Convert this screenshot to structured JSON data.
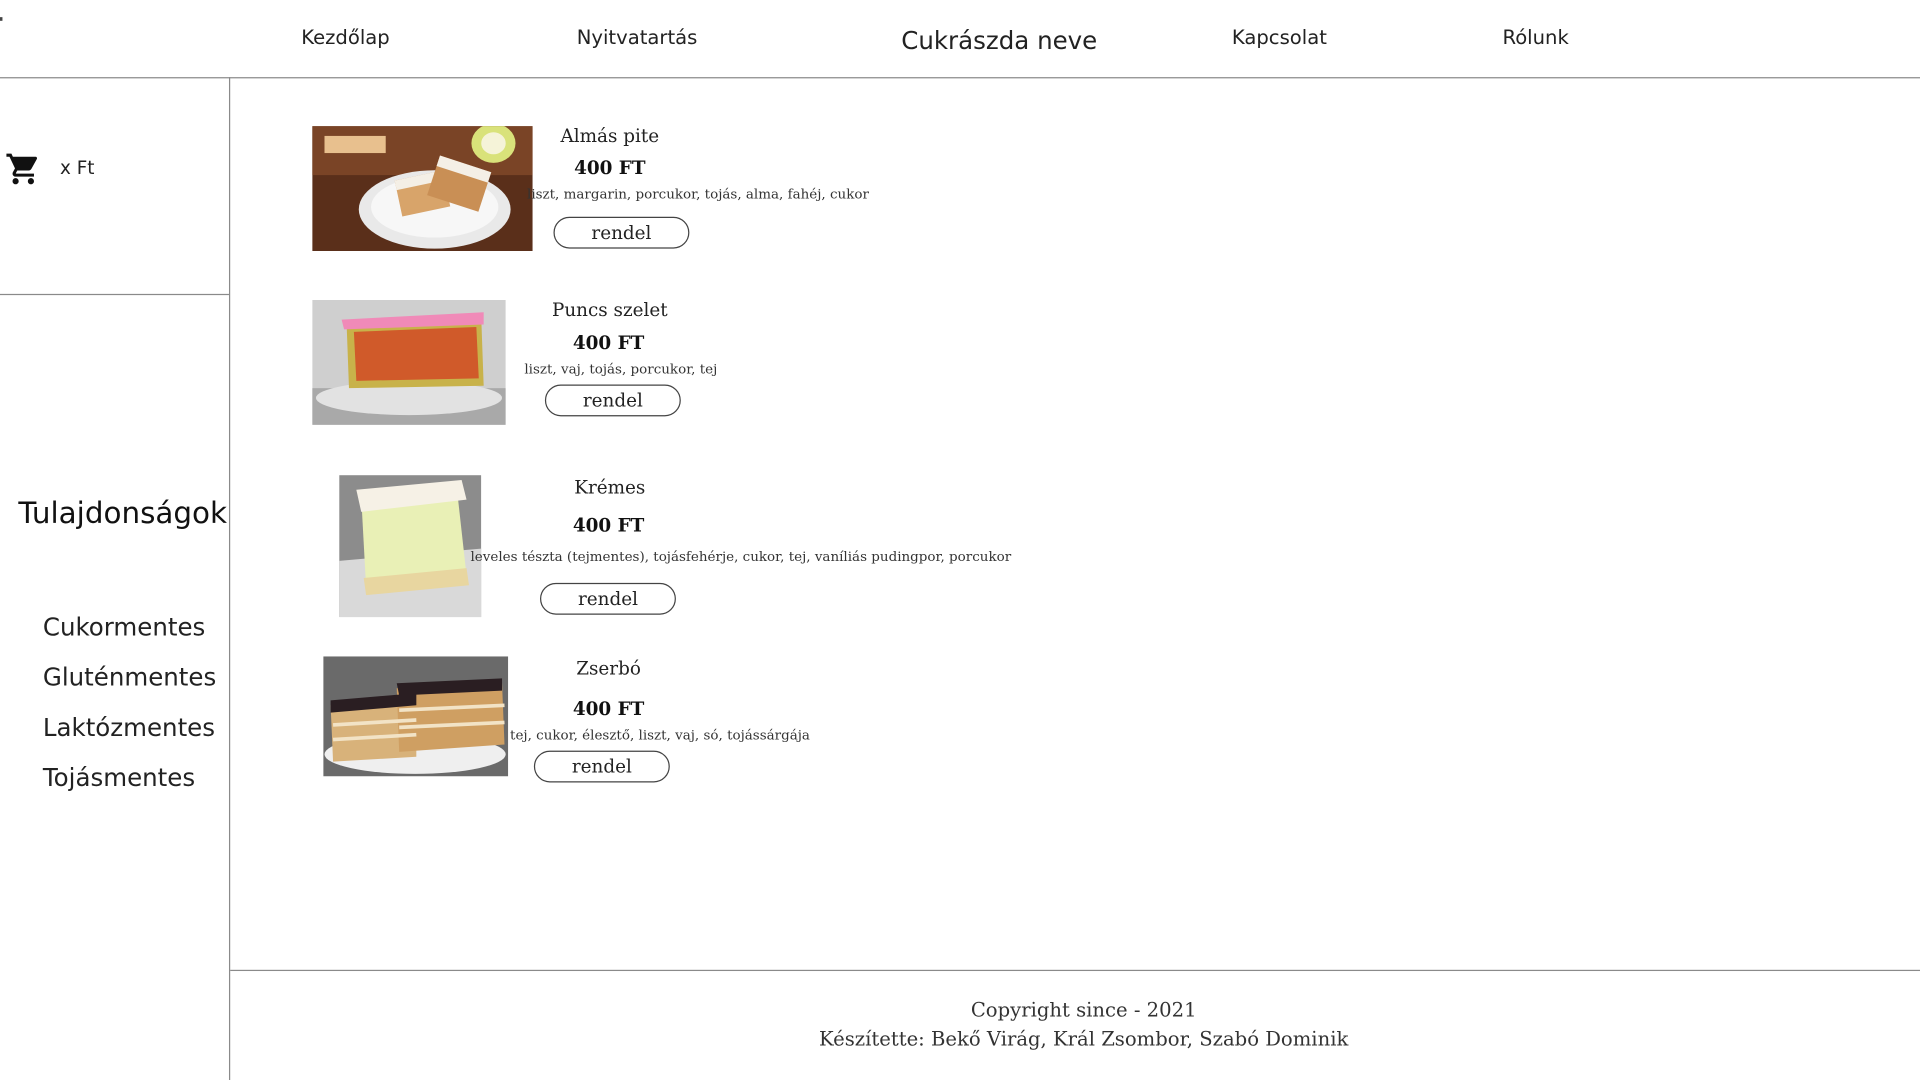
{
  "header": {
    "nav": [
      "Kezdőlap",
      "Nyitvatartás",
      "Kapcsolat",
      "Rólunk"
    ],
    "brand": "Cukrászda neve"
  },
  "sidebar": {
    "cart_amount": "x Ft",
    "title": "Tulajdonságok",
    "filters": [
      "Cukormentes",
      "Gluténmentes",
      "Laktózmentes",
      "Tojásmentes"
    ]
  },
  "products": [
    {
      "name": "Almás pite",
      "price": "400 FT",
      "ingredients": "liszt, margarin, porcukor, tojás, alma, fahéj, cukor",
      "button": "rendel"
    },
    {
      "name": "Puncs szelet",
      "price": "400 FT",
      "ingredients": "liszt, vaj, tojás, porcukor, tej",
      "button": "rendel"
    },
    {
      "name": "Krémes",
      "price": "400 FT",
      "ingredients": "leveles tészta (tejmentes), tojásfehérje, cukor, tej, vaníliás pudingpor, porcukor",
      "button": "rendel"
    },
    {
      "name": "Zserbó",
      "price": "400 FT",
      "ingredients": "tej, cukor, élesztő, liszt, vaj, só, tojássárgája",
      "button": "rendel"
    }
  ],
  "footer": {
    "copyright": "Copyright since - 2021",
    "credits": "Készítette: Bekő Virág, Král Zsombor, Szabó Dominik"
  },
  "icons": [
    "cart-icon"
  ]
}
